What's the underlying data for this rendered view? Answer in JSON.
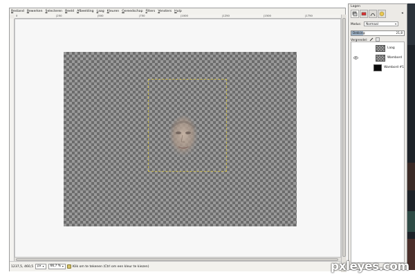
{
  "menubar": {
    "items": [
      "Bestand",
      "Bewerken",
      "Selecteren",
      "Beeld",
      "Afbeelding",
      "Laag",
      "Kleuren",
      "Gereedschap",
      "Filters",
      "Vensters",
      "Hulp"
    ]
  },
  "rulers": {
    "top_labels": [
      "0",
      "|250",
      "|500",
      "|750",
      "|1000",
      "|1250",
      "|1500",
      "|1750"
    ]
  },
  "statusbar": {
    "coordinates": "1237,5, 460,5",
    "unit": "px",
    "zoom": "66,7 %",
    "message": "Klik om te tekenen (Ctrl om een kleur te kiezen)"
  },
  "dock": {
    "title": "Lagen",
    "mode_label": "Modus:",
    "mode_value": "Normaal",
    "opacity_label": "Dekking:",
    "opacity_value": "21,8",
    "opacity_fraction": 0.218,
    "lock_label": "Vergrendel:",
    "layers": [
      {
        "name": "Laag",
        "visible": false,
        "thumb": "transparent"
      },
      {
        "name": "Wambord",
        "visible": true,
        "thumb": "transparent"
      },
      {
        "name": "Wambord #1",
        "visible": false,
        "thumb": "dark"
      }
    ]
  },
  "watermark": "pxleyes.com",
  "colors": {
    "selection": "#c9b94a",
    "checker_dark": "#6c6c6c",
    "checker_light": "#9a9a9a"
  }
}
